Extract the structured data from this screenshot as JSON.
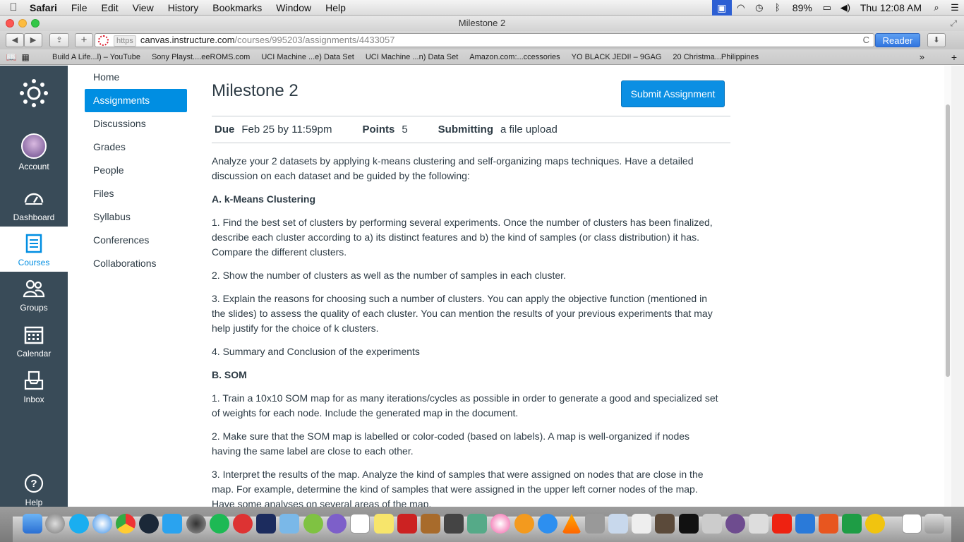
{
  "menubar": {
    "apple_icon": "apple-icon",
    "app_name": "Safari",
    "items": [
      "File",
      "Edit",
      "View",
      "History",
      "Bookmarks",
      "Window",
      "Help"
    ],
    "battery": "89%",
    "clock": "Thu 12:08 AM"
  },
  "window": {
    "title": "Milestone 2"
  },
  "toolbar": {
    "back": "◀",
    "forward": "▶",
    "share": "⇪",
    "new_tab": "+",
    "url_scheme": "https",
    "url_host": "canvas.instructure.com",
    "url_path": "/courses/995203/assignments/4433057",
    "reload": "C",
    "reader": "Reader",
    "download": "⬇"
  },
  "bookmarks": [
    "Build A Life...l) – YouTube",
    "Sony Playst....eeROMS.com",
    "UCI Machine ...e) Data Set",
    "UCI Machine ...n) Data Set",
    "Amazon.com:...ccessories",
    "YO BLACK JEDI! – 9GAG",
    "20 Christma...Philippines"
  ],
  "global_nav": [
    {
      "label": "Account"
    },
    {
      "label": "Dashboard"
    },
    {
      "label": "Courses"
    },
    {
      "label": "Groups"
    },
    {
      "label": "Calendar"
    },
    {
      "label": "Inbox"
    },
    {
      "label": "Help"
    }
  ],
  "course_nav": [
    "Home",
    "Assignments",
    "Discussions",
    "Grades",
    "People",
    "Files",
    "Syllabus",
    "Conferences",
    "Collaborations"
  ],
  "assignment": {
    "title": "Milestone 2",
    "submit_label": "Submit Assignment",
    "due_label": "Due",
    "due_value": "Feb 25 by 11:59pm",
    "points_label": "Points",
    "points_value": "5",
    "submitting_label": "Submitting",
    "submitting_value": "a file upload",
    "description": [
      {
        "type": "p",
        "text": "Analyze your 2 datasets by applying k-means clustering and self-organizing maps techniques. Have a detailed discussion on each dataset and be guided by the following:"
      },
      {
        "type": "h",
        "text": "A. k-Means Clustering"
      },
      {
        "type": "p",
        "text": "1. Find the best set of clusters by performing several experiments. Once the number of clusters has been finalized, describe each cluster according to a) its distinct features and b) the kind of samples (or class distribution) it has. Compare the different clusters."
      },
      {
        "type": "p",
        "text": "2. Show the number of clusters as well as the number of samples in each cluster."
      },
      {
        "type": "p",
        "text": "3. Explain the reasons for choosing such a number of clusters. You can apply the objective function (mentioned in the slides) to assess the quality of each cluster.  You can mention the results of your previous experiments that may help justify for the choice of k clusters."
      },
      {
        "type": "p",
        "text": "4. Summary and Conclusion of the experiments"
      },
      {
        "type": "h",
        "text": "B. SOM"
      },
      {
        "type": "p",
        "text": "1.  Train a 10x10 SOM map for as many iterations/cycles as possible in order to generate a good and specialized set of weights for each node. Include the generated map in the document."
      },
      {
        "type": "p",
        "text": "2. Make sure that the SOM map is labelled or color-coded (based on labels).  A map is well-organized if nodes having the same label are close to each other."
      },
      {
        "type": "p",
        "text": "3. Interpret the results of the map. Analyze the kind of samples that were assigned on nodes that are close in the map. For example, determine the kind of samples that were assigned in the upper left corner nodes of the map. Have some analyses on several areas of the map."
      }
    ]
  },
  "colors": {
    "canvas_nav_bg": "#394b58",
    "canvas_blue": "#008ee2",
    "text": "#2d3b45"
  }
}
